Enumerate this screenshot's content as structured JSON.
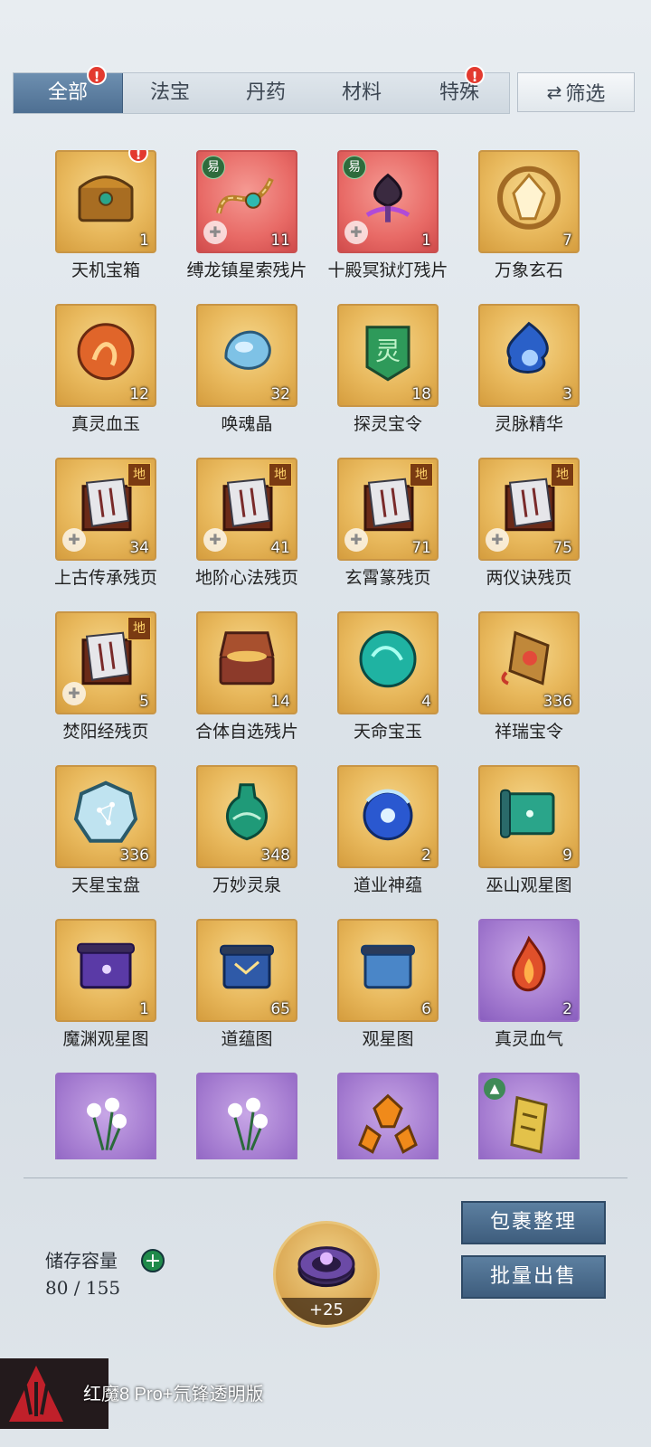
{
  "tabs": [
    {
      "label": "全部",
      "active": true,
      "alert": true
    },
    {
      "label": "法宝",
      "active": false,
      "alert": false
    },
    {
      "label": "丹药",
      "active": false,
      "alert": false
    },
    {
      "label": "材料",
      "active": false,
      "alert": false
    },
    {
      "label": "特殊",
      "active": false,
      "alert": true
    }
  ],
  "alert_glyph": "!",
  "filter": {
    "icon": "swap-arrows-icon",
    "arrows": "⇄",
    "label": "筛选"
  },
  "items": [
    {
      "name": "天机宝箱",
      "count": "1",
      "bg": "gold",
      "icon": "treasure-chest-icon",
      "alert": true
    },
    {
      "name": "缚龙镇星索残片",
      "count": "11",
      "bg": "red",
      "icon": "chain-rope-icon",
      "badge": "易",
      "puzzle": true
    },
    {
      "name": "十殿冥狱灯残片",
      "count": "1",
      "bg": "red",
      "icon": "dark-lotus-lamp-icon",
      "badge": "易",
      "puzzle": true
    },
    {
      "name": "万象玄石",
      "count": "7",
      "bg": "gold",
      "icon": "crystal-stone-icon"
    },
    {
      "name": "真灵血玉",
      "count": "12",
      "bg": "gold",
      "icon": "blood-jade-icon"
    },
    {
      "name": "唤魂晶",
      "count": "32",
      "bg": "gold",
      "icon": "soul-crystal-icon"
    },
    {
      "name": "探灵宝令",
      "count": "18",
      "bg": "gold",
      "icon": "spirit-token-icon"
    },
    {
      "name": "灵脉精华",
      "count": "3",
      "bg": "gold",
      "icon": "blue-flame-orb-icon"
    },
    {
      "name": "上古传承残页",
      "count": "34",
      "bg": "gold",
      "icon": "scroll-page-icon",
      "badge_di": "地",
      "puzzle": true
    },
    {
      "name": "地阶心法残页",
      "count": "41",
      "bg": "gold",
      "icon": "scroll-page-icon",
      "badge_di": "地",
      "puzzle": true
    },
    {
      "name": "玄霄篆残页",
      "count": "71",
      "bg": "gold",
      "icon": "scroll-page-icon",
      "badge_di": "地",
      "puzzle": true
    },
    {
      "name": "两仪诀残页",
      "count": "75",
      "bg": "gold",
      "icon": "scroll-page-icon",
      "badge_di": "地",
      "puzzle": true
    },
    {
      "name": "焚阳经残页",
      "count": "5",
      "bg": "gold",
      "icon": "scroll-page-icon",
      "badge_di": "地",
      "puzzle": true
    },
    {
      "name": "合体自选残片",
      "count": "14",
      "bg": "gold",
      "icon": "open-chest-icon"
    },
    {
      "name": "天命宝玉",
      "count": "4",
      "bg": "gold",
      "icon": "jade-orb-icon"
    },
    {
      "name": "祥瑞宝令",
      "count": "336",
      "bg": "gold",
      "icon": "auspicious-token-icon"
    },
    {
      "name": "天星宝盘",
      "count": "336",
      "bg": "gold",
      "icon": "star-plate-icon"
    },
    {
      "name": "万妙灵泉",
      "count": "348",
      "bg": "gold",
      "icon": "spring-vase-icon"
    },
    {
      "name": "道业神蕴",
      "count": "2",
      "bg": "gold",
      "icon": "blue-spirit-orb-icon"
    },
    {
      "name": "巫山观星图",
      "count": "9",
      "bg": "gold",
      "icon": "star-chart-scroll-icon"
    },
    {
      "name": "魔渊观星图",
      "count": "1",
      "bg": "gold",
      "icon": "purple-scroll-icon"
    },
    {
      "name": "道蕴图",
      "count": "65",
      "bg": "gold",
      "icon": "dao-scroll-icon"
    },
    {
      "name": "观星图",
      "count": "6",
      "bg": "gold",
      "icon": "blue-scroll-icon"
    },
    {
      "name": "真灵血气",
      "count": "2",
      "bg": "purple",
      "icon": "red-flame-icon"
    },
    {
      "name": "",
      "count": "",
      "bg": "purple",
      "icon": "white-flower-icon"
    },
    {
      "name": "",
      "count": "",
      "bg": "purple",
      "icon": "white-flower-icon"
    },
    {
      "name": "",
      "count": "",
      "bg": "purple",
      "icon": "amber-crystal-icon"
    },
    {
      "name": "",
      "count": "",
      "bg": "purple",
      "icon": "gold-talisman-icon",
      "badge_up": "▲"
    }
  ],
  "storage": {
    "label": "储存容量",
    "plus": "+",
    "value": "80 / 155"
  },
  "expand": {
    "icon": "storage-ring-icon",
    "label": "+25"
  },
  "buttons": {
    "organize": "包裹整理",
    "bulk_sell": "批量出售"
  },
  "footer": {
    "text": "红魔8 Pro+氘锋透明版"
  }
}
